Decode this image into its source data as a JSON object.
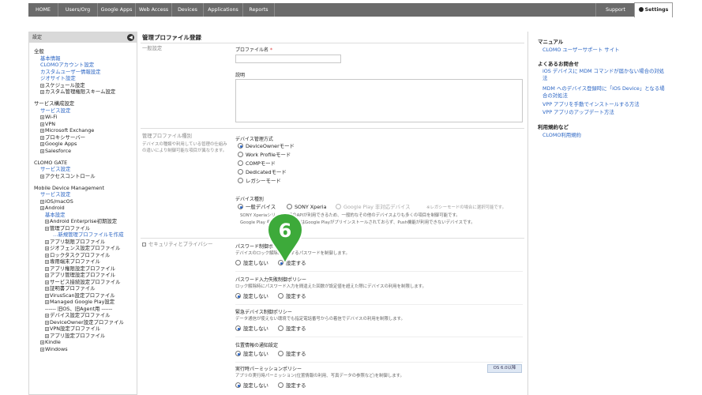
{
  "nav": {
    "items": [
      "HOME",
      "Users/Org",
      "Google Apps",
      "Web Access",
      "Devices",
      "Applications",
      "Reports"
    ],
    "support": "Support",
    "settings": "Settings"
  },
  "sidebar": {
    "header": "設定",
    "collapse_icon": "chevron-left-icon",
    "groups": [
      {
        "title": "全般",
        "items": [
          {
            "label": "基本情報",
            "link": true,
            "expander": false
          },
          {
            "label": "CLOMOアカウント設定",
            "link": true,
            "expander": false
          },
          {
            "label": "カスタムユーザー情報設定",
            "link": true,
            "expander": false
          },
          {
            "label": "ジオサイト設定",
            "link": true,
            "expander": false
          },
          {
            "label": "スケジュール設定",
            "link": false,
            "expander": true
          },
          {
            "label": "カスタム管理権限スキーム設定",
            "link": false,
            "expander": true
          }
        ]
      },
      {
        "title": "サービス構成設定",
        "items": [
          {
            "label": "サービス設定",
            "link": true,
            "expander": false
          },
          {
            "label": "Wi-Fi",
            "link": false,
            "expander": true
          },
          {
            "label": "VPN",
            "link": false,
            "expander": true
          },
          {
            "label": "Microsoft Exchange",
            "link": false,
            "expander": true
          },
          {
            "label": "プロキシサーバー",
            "link": false,
            "expander": true
          },
          {
            "label": "Google Apps",
            "link": false,
            "expander": true
          },
          {
            "label": "Salesforce",
            "link": false,
            "expander": true
          }
        ]
      },
      {
        "title": "CLOMO GATE",
        "items": [
          {
            "label": "サービス設定",
            "link": true,
            "expander": false
          },
          {
            "label": "アクセスコントロール",
            "link": false,
            "expander": true
          }
        ]
      },
      {
        "title": "Mobile Device Management",
        "items": [
          {
            "label": "サービス設定",
            "link": true,
            "expander": false
          },
          {
            "label": "iOS/macOS",
            "link": false,
            "expander": true
          },
          {
            "label": "Android",
            "link": false,
            "expander": true
          }
        ]
      }
    ],
    "android_items": [
      {
        "label": "基本設定",
        "link": true,
        "expander": false,
        "indent": 1
      },
      {
        "label": "Android Enterprise初期設定",
        "link": false,
        "expander": true,
        "indent": 1
      },
      {
        "label": "管理プロファイル",
        "link": false,
        "expander": true,
        "indent": 1
      },
      {
        "label": "…新規管理プロファイルを作成",
        "link": true,
        "expander": false,
        "indent": 2
      },
      {
        "label": "アプリ制限プロファイル",
        "link": false,
        "expander": true,
        "indent": 1
      },
      {
        "label": "ジオフェンス設定プロファイル",
        "link": false,
        "expander": true,
        "indent": 1
      },
      {
        "label": "ロックタスクプロファイル",
        "link": false,
        "expander": true,
        "indent": 1
      },
      {
        "label": "専用端末プロファイル",
        "link": false,
        "expander": true,
        "indent": 1
      },
      {
        "label": "アプリ権限設定プロファイル",
        "link": false,
        "expander": true,
        "indent": 1
      },
      {
        "label": "アプリ管理設定プロファイル",
        "link": false,
        "expander": true,
        "indent": 1
      },
      {
        "label": "サービス接続設定プロファイル",
        "link": false,
        "expander": true,
        "indent": 1
      },
      {
        "label": "証明書プロファイル",
        "link": false,
        "expander": true,
        "indent": 1
      },
      {
        "label": "VirusScan設定プロファイル",
        "link": false,
        "expander": true,
        "indent": 1
      },
      {
        "label": "Managed Google Play設定",
        "link": false,
        "expander": true,
        "indent": 1
      },
      {
        "label": "------ 旧OS、旧Agent用 ------",
        "link": false,
        "expander": false,
        "indent": 1
      },
      {
        "label": "デバイス設定プロファイル",
        "link": false,
        "expander": true,
        "indent": 1
      },
      {
        "label": "DeviceOwner設定プロファイル",
        "link": false,
        "expander": true,
        "indent": 1
      },
      {
        "label": "VPN設定プロファイル",
        "link": false,
        "expander": true,
        "indent": 1
      },
      {
        "label": "アプリ設定プロファイル",
        "link": false,
        "expander": true,
        "indent": 1
      }
    ],
    "tail_items": [
      {
        "label": "Kindle",
        "link": false,
        "expander": true
      },
      {
        "label": "Windows",
        "link": false,
        "expander": true
      }
    ]
  },
  "main": {
    "title": "管理プロファイル登録",
    "general": {
      "section": "一般設定",
      "name_label": "プロファイル名",
      "required_mark": "*",
      "name_value": "",
      "desc_label": "説明",
      "desc_value": ""
    },
    "type": {
      "section": "管理プロファイル種別",
      "section_note": "デバイスの種類や利用している管理の仕組みの違いにより制御可能な項目が異なります。",
      "mgmt_label": "デバイス管理方式",
      "mgmt_options": [
        "DeviceOwnerモード",
        "Work Profileモード",
        "COMPモード",
        "Dedicatedモード",
        "レガシーモード"
      ],
      "mgmt_selected": 0,
      "kind_label": "デバイス種別",
      "kind_options": [
        "一般デバイス",
        "SONY Xperia",
        "Google Play 非対応デバイス"
      ],
      "kind_selected": 0,
      "kind_hint": "※レガシーモードの場合に選択可能です。",
      "kind_note1": "SONY Xperiaシリーズ専用のAPIが利用できるため、一般的なその他のデバイスよりも多くの項目を制御可能です。",
      "kind_note2": "Google Play 非対応デバイスとはGoogle Playがプリインストールされておらず、Push機能が利用できないデバイスです。"
    },
    "security": {
      "section": "セキュリティとプライバシー",
      "items": [
        {
          "label": "パスワード制御ポリシー",
          "desc": "デバイスのロック解除に使用するパスワードを制御します。",
          "options": [
            "設定しない",
            "設定する"
          ],
          "selected": 1,
          "badge": ""
        },
        {
          "label": "パスワード入力失敗制御ポリシー",
          "desc": "ロック解除時にパスワード入力を間違えた回数が設定値を超えた際にデバイスの利用を制限します。",
          "options": [
            "設定しない",
            "設定する"
          ],
          "selected": 0,
          "badge": ""
        },
        {
          "label": "緊急デバイス制御ポリシー",
          "desc": "データ通信が使えない環境でも指定電話番号からの着信でデバイスの利用を制限します。",
          "options": [
            "設定しない",
            "設定する"
          ],
          "selected": 0,
          "badge": ""
        },
        {
          "label": "位置情報の通知設定",
          "desc": "",
          "options": [
            "設定しない",
            "設定する"
          ],
          "selected": 0,
          "badge": ""
        },
        {
          "label": "実行時パーミッションポリシー",
          "desc": "アプリの実行時パーミッション(位置情報の利用、写真データの参照など)を制御します。",
          "options": [
            "設定しない",
            "設定する"
          ],
          "selected": 0,
          "badge": "OS 6.0以降"
        }
      ]
    },
    "step_marker": "6"
  },
  "right": {
    "manual_title": "マニュアル",
    "manual_links": [
      "CLOMO ユーザーサポート サイト"
    ],
    "faq_title": "よくあるお問合せ",
    "faq_links": [
      "iOS デバイスに MDM コマンドが届かない場合の対処法",
      "MDM へのデバイス登録時に「iOS Device」となる場合の対処法",
      "VPP アプリを手動でインストールする方法",
      "VPP アプリのアップデート方法"
    ],
    "terms_title": "利用規約など",
    "terms_links": [
      "CLOMO利用規約"
    ]
  },
  "colors": {
    "nav_bg": "#6b6b6b",
    "link": "#2a64c3",
    "marker": "#3daa3a"
  }
}
